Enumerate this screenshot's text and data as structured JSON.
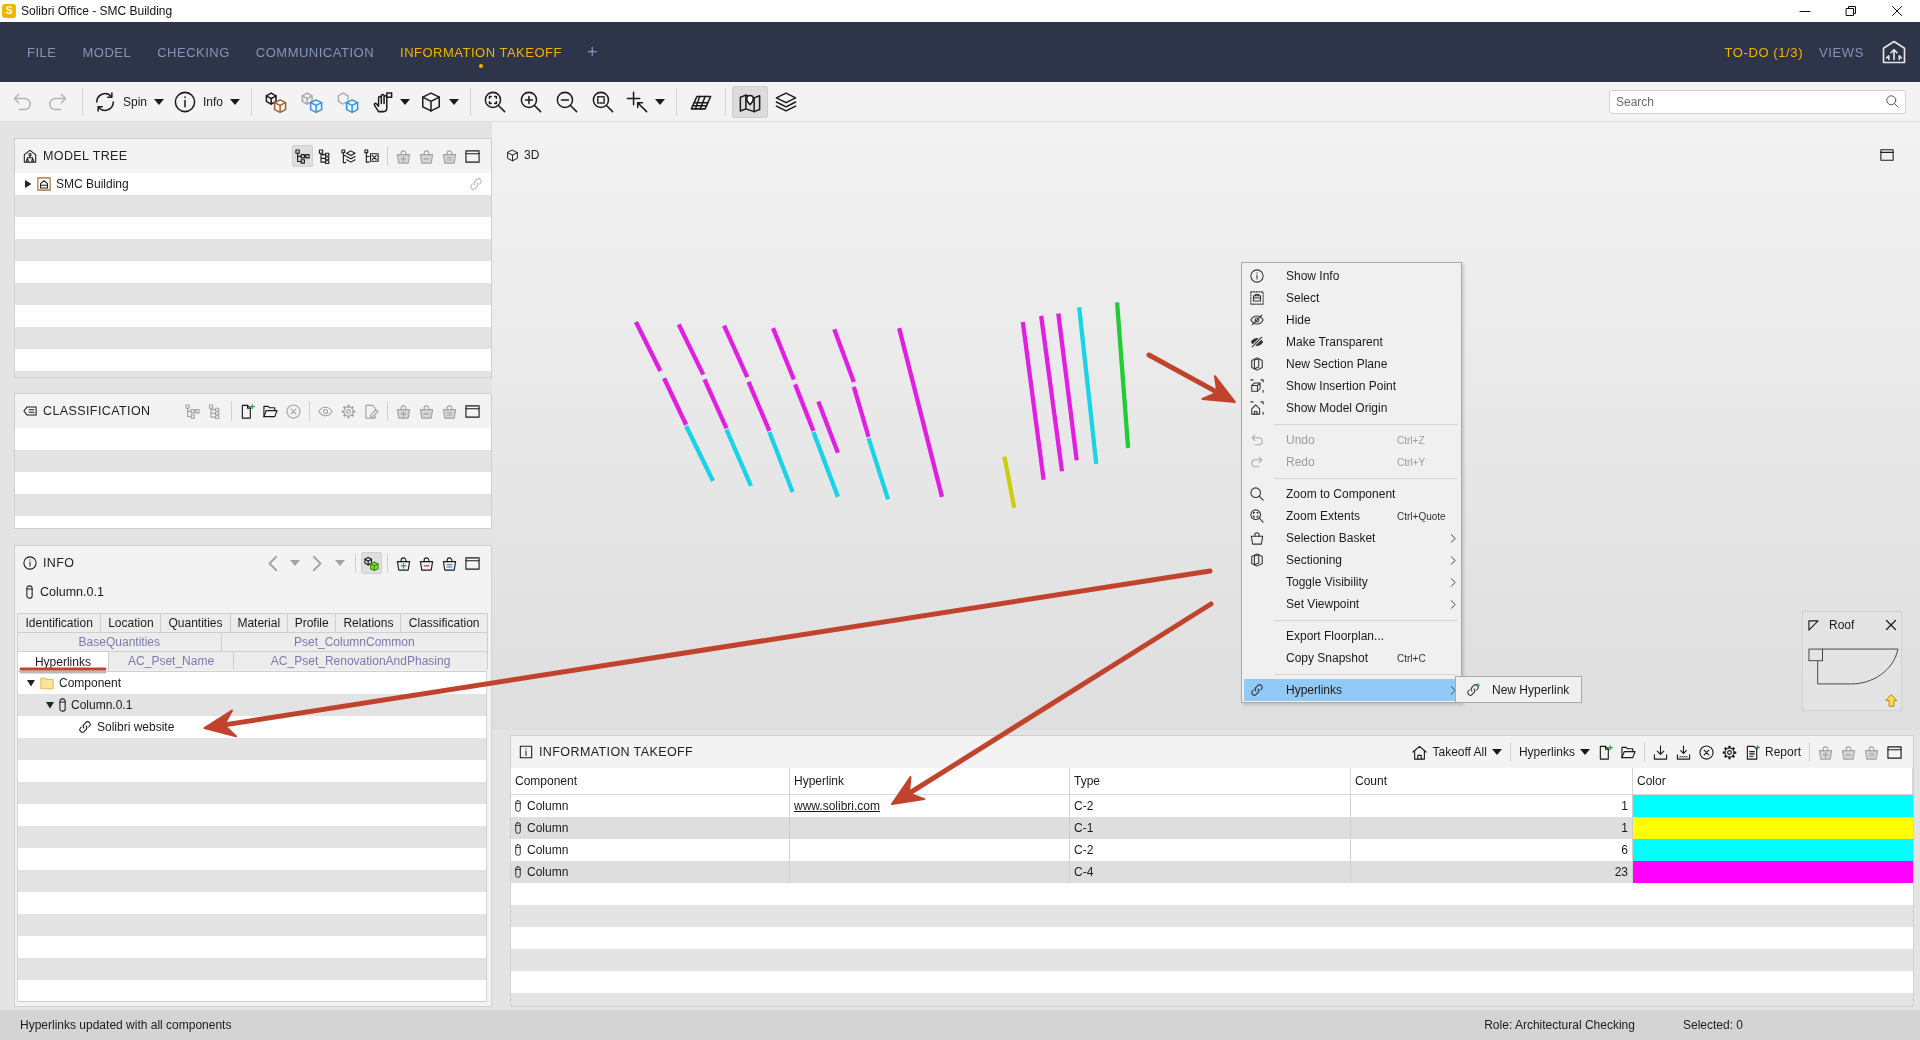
{
  "window": {
    "logo": "S",
    "title": "Solibri Office - SMC Building"
  },
  "menu_bar": {
    "tabs": [
      {
        "label": "FILE",
        "selected": false
      },
      {
        "label": "MODEL",
        "selected": false
      },
      {
        "label": "CHECKING",
        "selected": false
      },
      {
        "label": "COMMUNICATION",
        "selected": false
      },
      {
        "label": "INFORMATION TAKEOFF",
        "selected": true
      }
    ],
    "add_tab": "+",
    "right_items": [
      {
        "label": "TO-DO (1/3)",
        "highlighted": true
      },
      {
        "label": "VIEWS",
        "highlighted": false
      }
    ]
  },
  "toolbar": {
    "groups": [
      [
        {
          "on": false,
          "disabled": true
        },
        {
          "on": false,
          "disabled": true
        }
      ],
      [
        {
          "label": "Spin",
          "dropdown": true,
          "on": false,
          "disabled": false
        },
        {
          "label": "Info",
          "dropdown": true,
          "on": false,
          "disabled": false
        }
      ],
      [
        {
          "on": false,
          "disabled": false
        },
        {
          "on": false,
          "disabled": false
        },
        {
          "on": false,
          "disabled": false
        },
        {
          "dropdown": true,
          "on": false,
          "disabled": false
        },
        {
          "dropdown": true,
          "on": false,
          "disabled": false
        }
      ],
      [
        {
          "on": false,
          "disabled": false
        },
        {
          "on": false,
          "disabled": false
        },
        {
          "on": false,
          "disabled": false
        },
        {
          "on": false,
          "disabled": false
        },
        {
          "dropdown": true,
          "on": false,
          "disabled": false
        }
      ],
      [
        {
          "on": false,
          "disabled": false
        }
      ],
      [
        {
          "on": true,
          "disabled": false
        },
        {
          "on": false,
          "disabled": false
        }
      ]
    ],
    "search": {
      "placeholder": "Search"
    }
  },
  "model_tree": {
    "title": "MODEL TREE",
    "tool_groups": [
      [
        {
          "on": true,
          "disabled": false
        },
        {
          "on": false,
          "disabled": false
        },
        {
          "on": false,
          "disabled": false
        },
        {
          "on": false,
          "disabled": false
        }
      ],
      [
        {
          "on": false,
          "disabled": true
        },
        {
          "on": false,
          "disabled": true
        },
        {
          "on": false,
          "disabled": true
        },
        {
          "on": false,
          "disabled": false
        }
      ]
    ],
    "tree": [
      {
        "label": "SMC Building",
        "kind": "building",
        "expanded": false
      }
    ]
  },
  "classification": {
    "title": "CLASSIFICATION",
    "tool_groups": [
      [
        {
          "on": false,
          "disabled": true
        },
        {
          "on": false,
          "disabled": true
        }
      ],
      [
        {
          "on": false,
          "disabled": false
        },
        {
          "on": false,
          "disabled": false
        },
        {
          "on": false,
          "disabled": true
        }
      ],
      [
        {
          "on": false,
          "disabled": true
        },
        {
          "on": false,
          "disabled": true
        },
        {
          "on": false,
          "disabled": true
        }
      ],
      [
        {
          "on": false,
          "disabled": true
        },
        {
          "on": false,
          "disabled": true
        },
        {
          "on": false,
          "disabled": true
        },
        {
          "on": false,
          "disabled": false
        }
      ]
    ]
  },
  "info": {
    "title": "INFO",
    "tool_groups": [
      [
        {
          "on": false,
          "disabled": true
        },
        {
          "on": false,
          "disabled": true
        },
        {
          "on": false,
          "disabled": true
        },
        {
          "on": false,
          "disabled": true
        }
      ],
      [
        {
          "on": true,
          "disabled": false
        }
      ],
      [
        {
          "on": false,
          "disabled": false
        },
        {
          "on": false,
          "disabled": false
        },
        {
          "on": false,
          "disabled": false
        },
        {
          "on": false,
          "disabled": false
        }
      ]
    ],
    "component": "Column.0.1",
    "tab_rows": [
      [
        {
          "label": "Identification",
          "selected": false
        },
        {
          "label": "Location",
          "selected": false
        },
        {
          "label": "Quantities",
          "selected": false
        },
        {
          "label": "Material",
          "selected": false
        },
        {
          "label": "Profile",
          "selected": false
        },
        {
          "label": "Relations",
          "selected": false
        },
        {
          "label": "Classification",
          "selected": false
        }
      ],
      [
        {
          "label": "BaseQuantities",
          "selected": false
        },
        {
          "label": "Pset_ColumnCommon",
          "selected": false
        }
      ],
      [
        {
          "label": "Hyperlinks",
          "selected": true
        },
        {
          "label": "AC_Pset_Name",
          "selected": false
        },
        {
          "label": "AC_Pset_RenovationAndPhasing",
          "selected": false
        }
      ]
    ],
    "tree": [
      {
        "label": "Component",
        "kind": "group",
        "expanded": true,
        "children": [
          {
            "label": "Column.0.1",
            "kind": "component",
            "expanded": true,
            "children": [
              {
                "label": "Solibri website",
                "kind": "hyperlink"
              }
            ]
          }
        ]
      }
    ]
  },
  "viewport": {
    "title": "3D",
    "floor_widget": {
      "label": "Roof"
    }
  },
  "context_menu": {
    "groups": [
      [
        {
          "label": "Show Info",
          "selected": false,
          "disabled": false,
          "submenu": false
        },
        {
          "label": "Select",
          "selected": false,
          "disabled": false,
          "submenu": false
        },
        {
          "label": "Hide",
          "selected": false,
          "disabled": false,
          "submenu": false
        },
        {
          "label": "Make Transparent",
          "selected": false,
          "disabled": false,
          "submenu": false
        },
        {
          "label": "New Section Plane",
          "selected": false,
          "disabled": false,
          "submenu": false
        },
        {
          "label": "Show Insertion Point",
          "selected": false,
          "disabled": false,
          "submenu": false
        },
        {
          "label": "Show Model Origin",
          "selected": false,
          "disabled": false,
          "submenu": false
        }
      ],
      [
        {
          "label": "Undo",
          "shortcut": "Ctrl+Z",
          "selected": false,
          "disabled": true,
          "submenu": false
        },
        {
          "label": "Redo",
          "shortcut": "Ctrl+Y",
          "selected": false,
          "disabled": true,
          "submenu": false
        }
      ],
      [
        {
          "label": "Zoom to Component",
          "selected": false,
          "disabled": false,
          "submenu": false
        },
        {
          "label": "Zoom Extents",
          "shortcut": "Ctrl+Quote",
          "selected": false,
          "disabled": false,
          "submenu": false
        },
        {
          "label": "Selection Basket",
          "selected": false,
          "disabled": false,
          "submenu": true
        },
        {
          "label": "Sectioning",
          "selected": false,
          "disabled": false,
          "submenu": true
        },
        {
          "label": "Toggle Visibility",
          "selected": false,
          "disabled": false,
          "submenu": true
        },
        {
          "label": "Set Viewpoint",
          "selected": false,
          "disabled": false,
          "submenu": true
        }
      ],
      [
        {
          "label": "Export Floorplan...",
          "selected": false,
          "disabled": false,
          "submenu": false
        },
        {
          "label": "Copy Snapshot",
          "shortcut": "Ctrl+C",
          "selected": false,
          "disabled": false,
          "submenu": false
        }
      ],
      [
        {
          "label": "Hyperlinks",
          "selected": true,
          "disabled": false,
          "submenu": true
        }
      ]
    ],
    "submenu": {
      "items": [
        {
          "label": "New Hyperlink",
          "selected": false
        }
      ]
    }
  },
  "takeoff": {
    "title": "INFORMATION TAKEOFF",
    "tool_groups": [
      [
        {
          "label": "Takeoff All",
          "dropdown": true,
          "on": false,
          "disabled": false
        }
      ],
      [
        {
          "label": "Hyperlinks",
          "dropdown": true,
          "on": false,
          "disabled": false
        },
        {
          "on": false,
          "disabled": false
        },
        {
          "on": false,
          "disabled": false
        }
      ],
      [
        {
          "on": false,
          "disabled": false
        },
        {
          "on": false,
          "disabled": false
        },
        {
          "on": false,
          "disabled": false
        },
        {
          "on": false,
          "disabled": false
        },
        {
          "label": "Report",
          "on": false,
          "disabled": false
        }
      ],
      [
        {
          "on": false,
          "disabled": true
        },
        {
          "on": false,
          "disabled": true
        },
        {
          "on": false,
          "disabled": true
        },
        {
          "on": false,
          "disabled": false
        }
      ]
    ],
    "columns": [
      "Component",
      "Hyperlink",
      "Type",
      "Count",
      "Color"
    ],
    "rows": [
      {
        "component": "Column",
        "hyperlink": "www.solibri.com",
        "type": "C-2",
        "count": "1",
        "color": "#00ffff"
      },
      {
        "component": "Column",
        "type": "C-1",
        "count": "1",
        "color": "#ffff00"
      },
      {
        "component": "Column",
        "type": "C-2",
        "count": "6",
        "color": "#00ffff"
      },
      {
        "component": "Column",
        "type": "C-4",
        "count": "23",
        "color": "#ff00ff"
      }
    ]
  },
  "status_bar": {
    "message": "Hyperlinks updated with all components",
    "role": "Role: Architectural Checking",
    "selection": "Selected: 0"
  }
}
